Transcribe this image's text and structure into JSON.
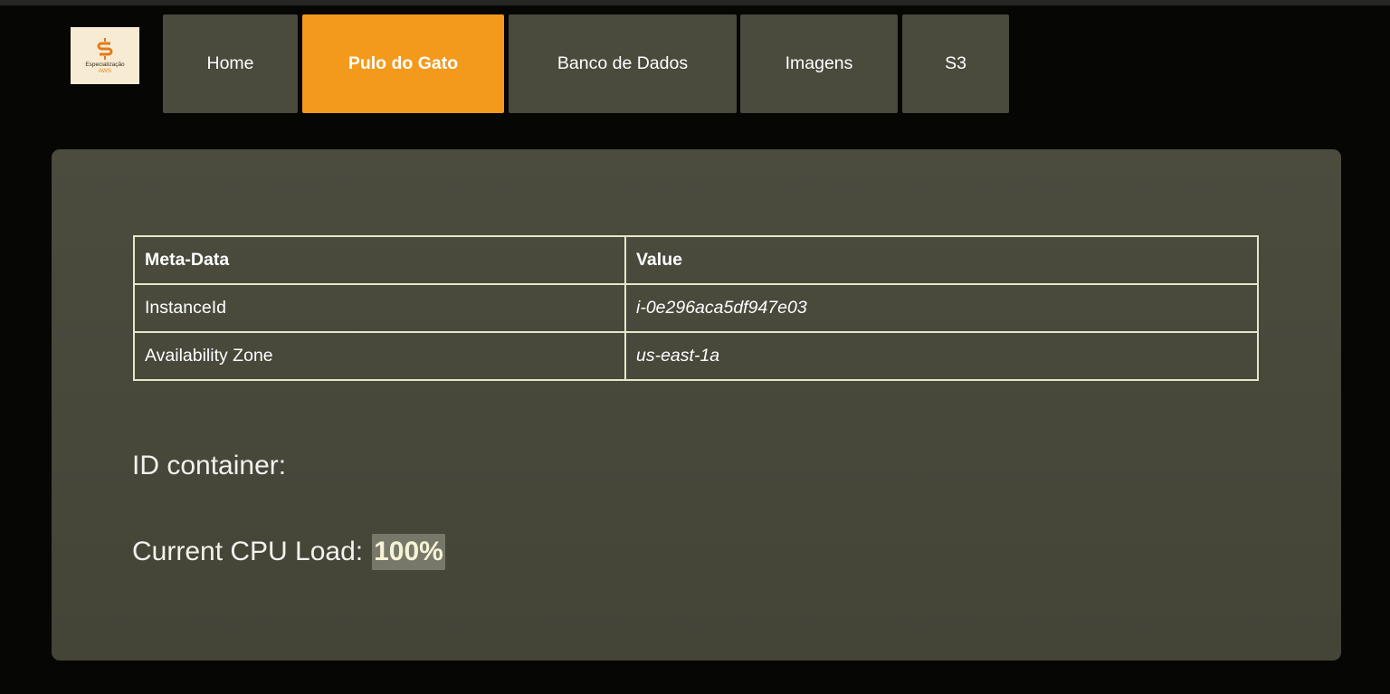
{
  "colors": {
    "background": "#060605",
    "nav_item": "#4a4a3d",
    "nav_active": "#f39a1d",
    "panel": "#4b4b3e",
    "table_border": "#e8e6c8",
    "highlight": "#77786a"
  },
  "logo": {
    "icon": "dollar-s-logo-icon",
    "line1": "Especialização",
    "line2": "AWS"
  },
  "nav": {
    "items": [
      {
        "label": "Home",
        "active": false
      },
      {
        "label": "Pulo do Gato",
        "active": true
      },
      {
        "label": "Banco de Dados",
        "active": false
      },
      {
        "label": "Imagens",
        "active": false
      },
      {
        "label": "S3",
        "active": false
      }
    ]
  },
  "table": {
    "headers": [
      "Meta-Data",
      "Value"
    ],
    "rows": [
      [
        "InstanceId",
        "i-0e296aca5df947e03"
      ],
      [
        "Availability Zone",
        "us-east-1a"
      ]
    ]
  },
  "info": {
    "id_container_label": "ID container:",
    "cpu_label": "Current CPU Load:",
    "cpu_value": "100%"
  }
}
